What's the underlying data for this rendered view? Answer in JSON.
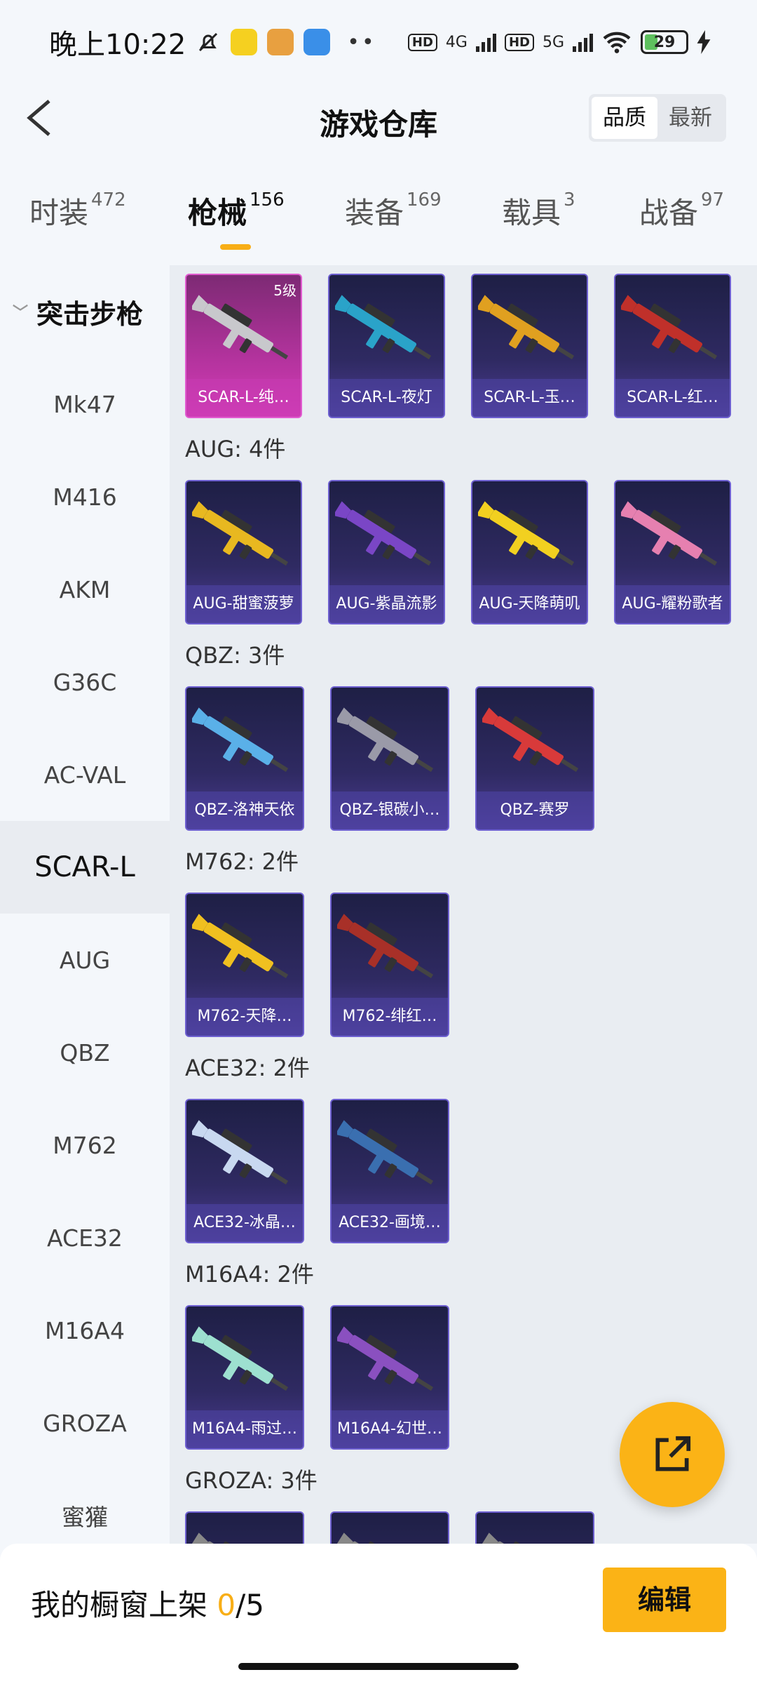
{
  "status_bar": {
    "time": "晚上10:22",
    "net1": "4G",
    "net2": "5G",
    "battery": "29"
  },
  "header": {
    "title": "游戏仓库",
    "sort_options": [
      "品质",
      "最新"
    ],
    "active_sort": "品质"
  },
  "tabs": [
    {
      "label": "时装",
      "count": "472"
    },
    {
      "label": "枪械",
      "count": "156"
    },
    {
      "label": "装备",
      "count": "169"
    },
    {
      "label": "载具",
      "count": "3"
    },
    {
      "label": "战备",
      "count": "97"
    }
  ],
  "sidebar": {
    "group": "突击步枪",
    "items": [
      "Mk47",
      "M416",
      "AKM",
      "G36C",
      "AC-VAL",
      "SCAR-L",
      "AUG",
      "QBZ",
      "M762",
      "ACE32",
      "M16A4",
      "GROZA",
      "蜜獾"
    ],
    "active": "SCAR-L"
  },
  "sections": [
    {
      "title": "",
      "items": [
        {
          "name": "SCAR-L-纯…",
          "level": "5级",
          "color": "#c8c8cc"
        },
        {
          "name": "SCAR-L-夜灯",
          "color": "#2aa3c9"
        },
        {
          "name": "SCAR-L-玉…",
          "color": "#e0a020"
        },
        {
          "name": "SCAR-L-红…",
          "color": "#c0302a"
        }
      ]
    },
    {
      "title": "AUG: 4件",
      "items": [
        {
          "name": "AUG-甜蜜菠萝",
          "color": "#e8b820"
        },
        {
          "name": "AUG-紫晶流影",
          "color": "#7a46c6"
        },
        {
          "name": "AUG-天降萌叽",
          "color": "#f2d020"
        },
        {
          "name": "AUG-耀粉歌者",
          "color": "#e680b0"
        }
      ]
    },
    {
      "title": "QBZ: 3件",
      "items": [
        {
          "name": "QBZ-洛神天依",
          "color": "#5ab0e8"
        },
        {
          "name": "QBZ-银碳小…",
          "color": "#9a9aa8"
        },
        {
          "name": "QBZ-赛罗",
          "color": "#d83a3a"
        }
      ]
    },
    {
      "title": "M762: 2件",
      "items": [
        {
          "name": "M762-天降…",
          "color": "#f0c020"
        },
        {
          "name": "M762-绯红…",
          "color": "#a83028"
        }
      ]
    },
    {
      "title": "ACE32: 2件",
      "items": [
        {
          "name": "ACE32-冰晶…",
          "color": "#c8d8f0"
        },
        {
          "name": "ACE32-画境…",
          "color": "#3a6fb0"
        }
      ]
    },
    {
      "title": "M16A4: 2件",
      "items": [
        {
          "name": "M16A4-雨过…",
          "color": "#9de0d0"
        },
        {
          "name": "M16A4-幻世…",
          "color": "#8a50c0"
        }
      ]
    },
    {
      "title": "GROZA: 3件",
      "items": [
        {
          "name": "",
          "color": "#888"
        },
        {
          "name": "",
          "color": "#888"
        },
        {
          "name": "",
          "color": "#888"
        }
      ]
    }
  ],
  "bottom": {
    "label": "我的橱窗上架",
    "current": "0",
    "total": "/5",
    "edit": "编辑"
  },
  "fab": {
    "icon": "share-external-icon"
  }
}
